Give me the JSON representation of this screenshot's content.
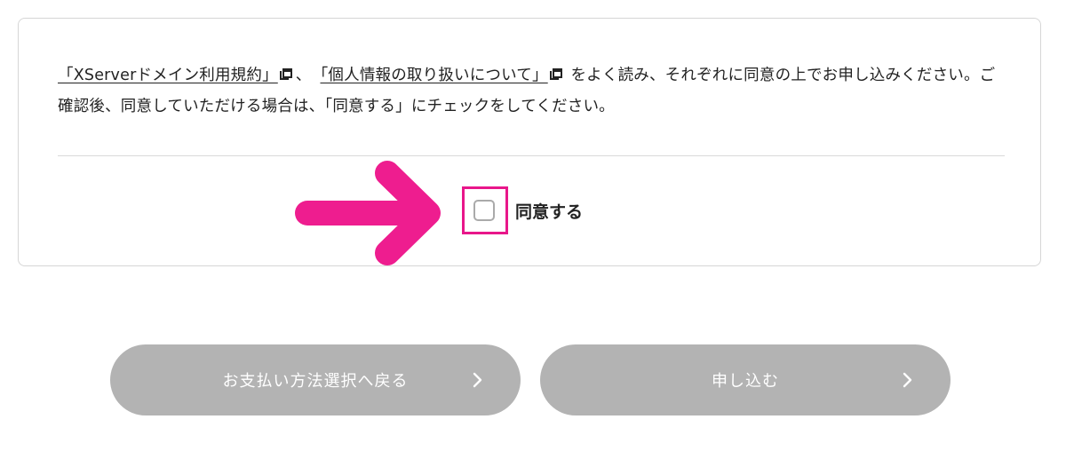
{
  "terms": {
    "link1": "「XServerドメイン利用規約」",
    "sep": "、",
    "link2": "「個人情報の取り扱いについて」",
    "rest": "をよく読み、それぞれに同意の上でお申し込みください。ご確認後、同意していただける場合は、「同意する」にチェックをしてください。"
  },
  "agreement": {
    "label": "同意する",
    "checked": false
  },
  "buttons": {
    "back_label": "お支払い方法選択へ戻る",
    "apply_label": "申し込む"
  },
  "icons": {
    "external_link": "external-link-icon",
    "chevron": "chevron-right-icon",
    "arrow": "arrow-right-icon"
  },
  "colors": {
    "highlight": "#e8178a",
    "button_disabled": "#b3b3b3"
  }
}
